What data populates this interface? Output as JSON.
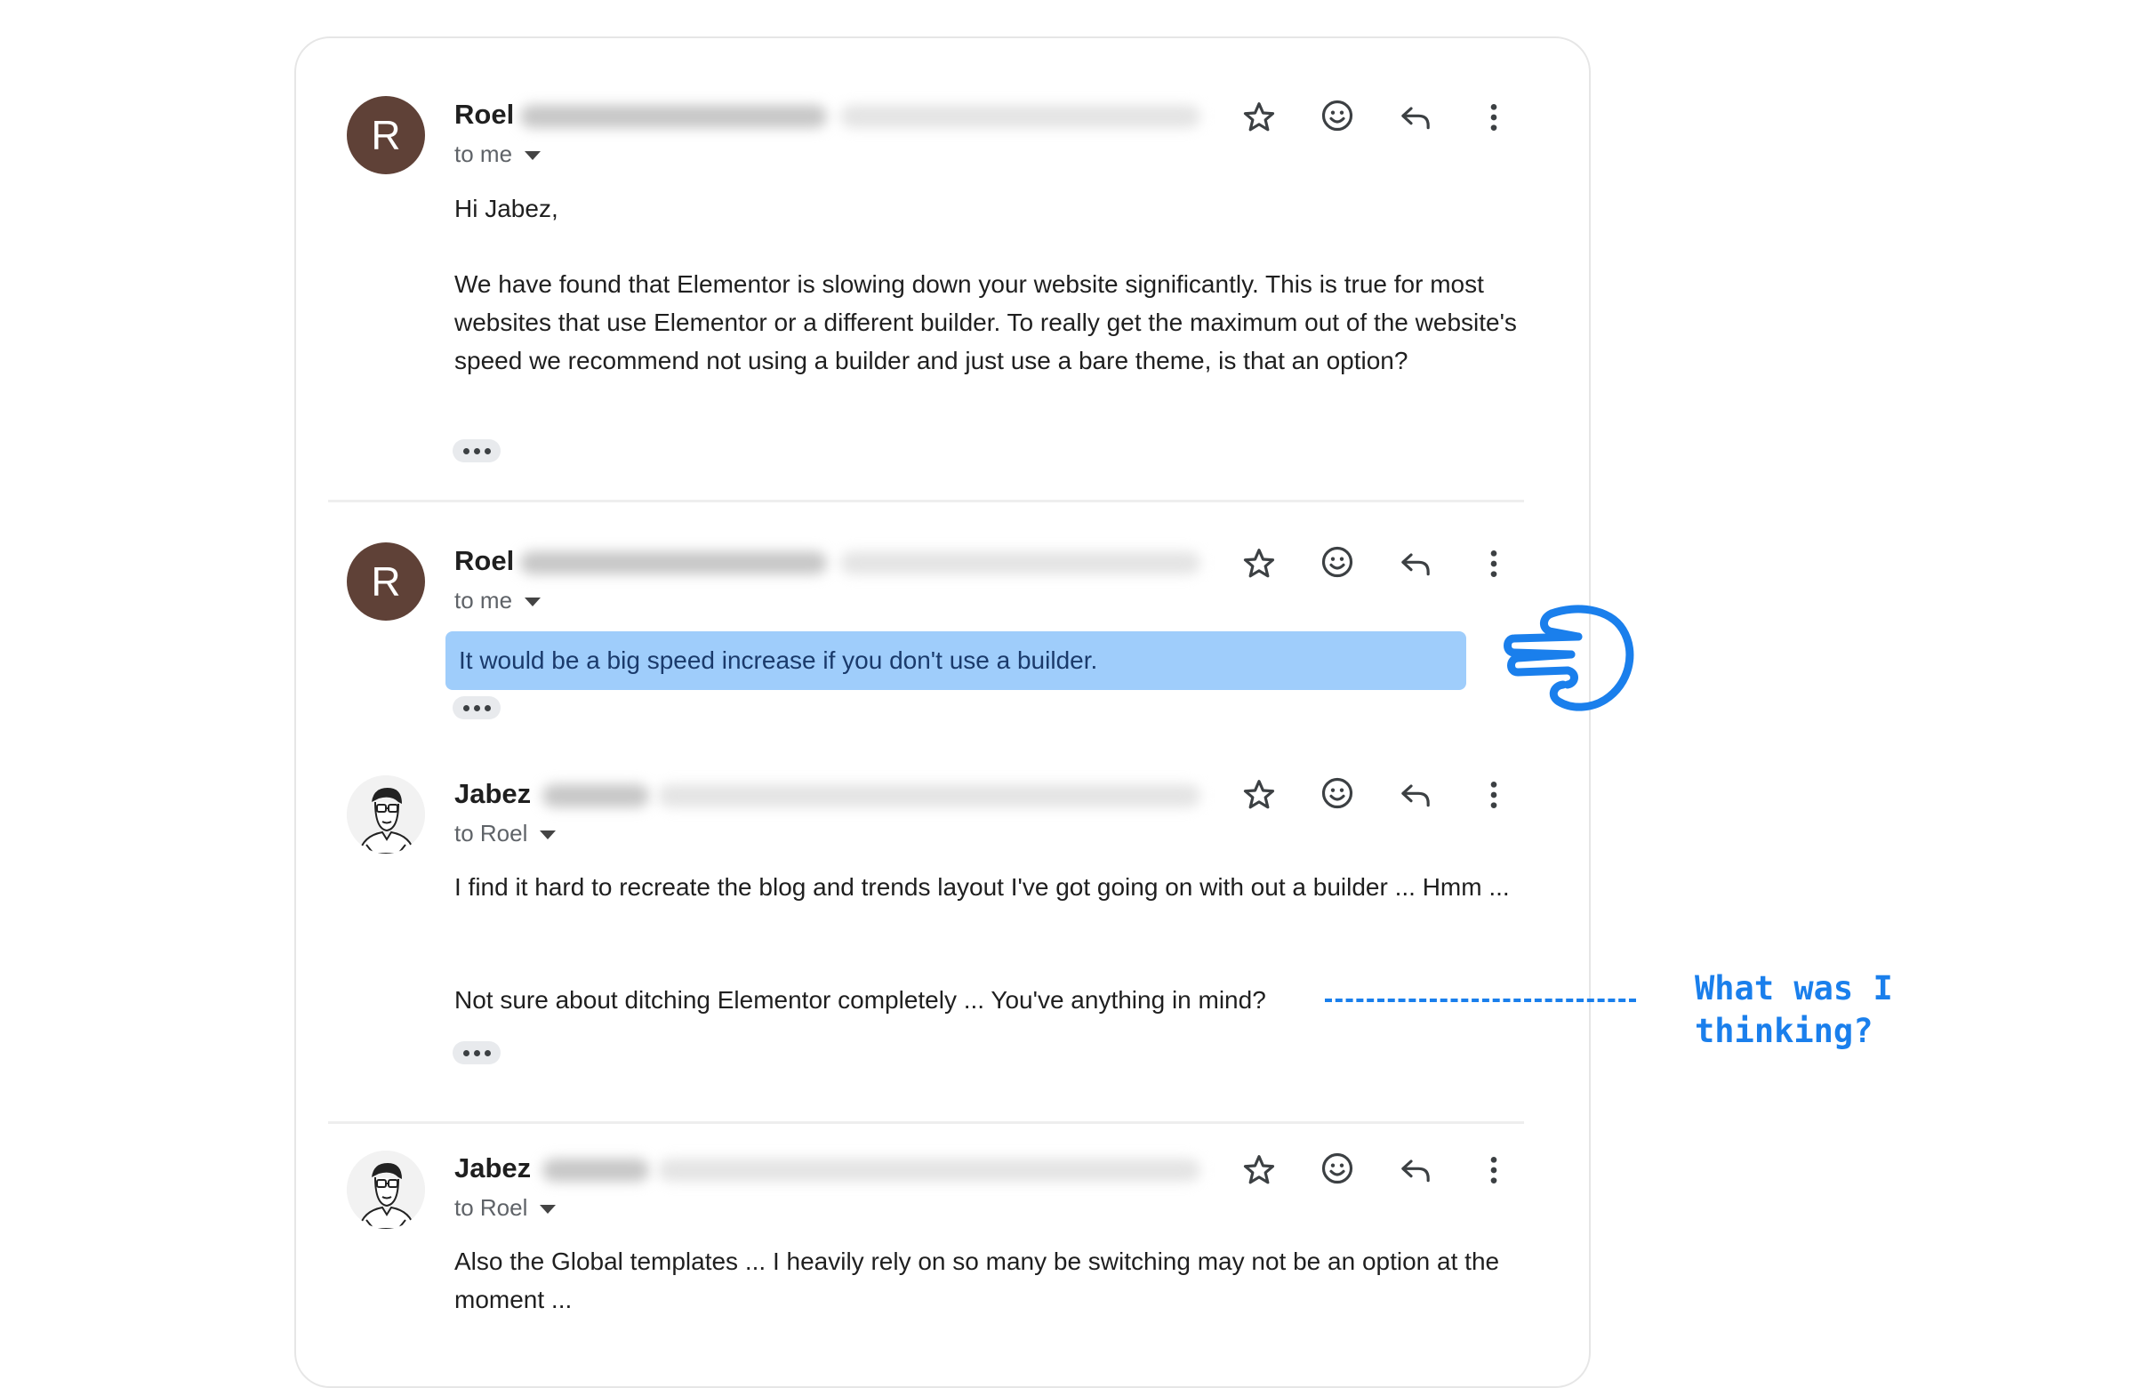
{
  "colors": {
    "accent_blue": "#1a7fec",
    "highlight": "#9fcdfb",
    "avatar_letter_bg": "#5f4137"
  },
  "icons": {
    "star": "star-icon",
    "emoji": "emoji-icon",
    "reply": "reply-icon",
    "more": "more-vert-icon",
    "recipients": "caret-down-icon",
    "pointer": "pointing-hand-icon"
  },
  "messages": [
    {
      "sender": "Roel",
      "avatar_letter": "R",
      "recipient": "to me",
      "paragraphs": [
        "Hi Jabez,",
        "We have found that Elementor is slowing down your website significantly. This is true for most websites that use Elementor or a different builder. To really get the maximum out of the website's speed we recommend not using a builder and just use a bare theme, is that an option?"
      ]
    },
    {
      "sender": "Roel",
      "avatar_letter": "R",
      "recipient": "to me",
      "highlighted": "It would be a big speed increase if you don't use a builder."
    },
    {
      "sender": "Jabez",
      "recipient": "to Roel",
      "paragraphs": [
        "I find it hard to recreate the blog and trends layout I've got going on with out a builder ... Hmm ...",
        "Not sure about ditching Elementor completely ... You've anything in mind?"
      ]
    },
    {
      "sender": "Jabez",
      "recipient": "to Roel",
      "paragraphs": [
        "Also the Global templates ... I heavily rely on so many be switching may not be an option at the moment ..."
      ]
    }
  ],
  "annotation": "What was I thinking?"
}
